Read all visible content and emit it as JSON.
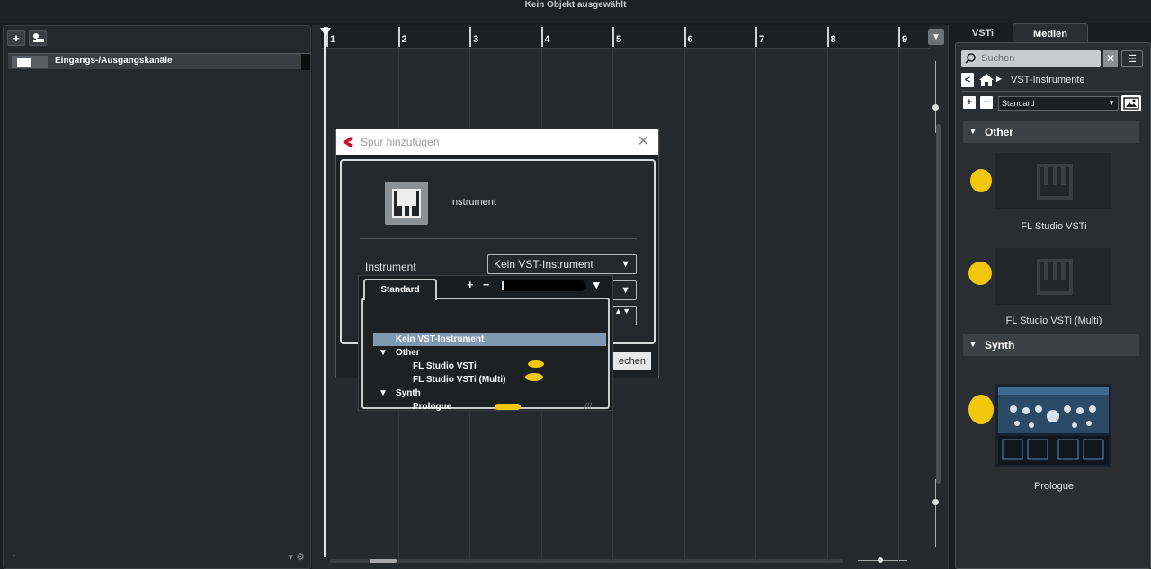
{
  "topbar": {
    "title": "Kein Objekt ausgewählt"
  },
  "left": {
    "add_label": "+",
    "track_label": "Eingangs-/Ausgangskanäle",
    "bottom_dash": "-",
    "bottom_controls": "▾ ⚙"
  },
  "ruler": {
    "bars": [
      "1",
      "2",
      "3",
      "4",
      "5",
      "6",
      "7",
      "8",
      "9"
    ]
  },
  "right": {
    "tabs": [
      "VSTi",
      "Medien"
    ],
    "search_placeholder": "Suchen",
    "clear": "✕",
    "list": "☰",
    "back": "<",
    "crumb": "VST-Instrumente",
    "plus": "+",
    "minus": "−",
    "preset": "Standard",
    "sections": [
      {
        "title": "Other",
        "items": [
          "FL Studio VSTi",
          "FL Studio VSTi (Multi)"
        ]
      },
      {
        "title": "Synth",
        "items": [
          "Prologue"
        ]
      }
    ]
  },
  "dialog": {
    "title": "Spur hinzufügen",
    "close": "✕",
    "instrument_type": "Instrument",
    "field_label": "Instrument",
    "field_value": "Kein VST-Instrument",
    "dd_arrow": "▼",
    "spinner": "▲▼",
    "button": "echen"
  },
  "popup": {
    "tab": "Standard",
    "plus": "+",
    "minus": "−",
    "menu_arrow": "▾",
    "items": [
      {
        "label": "Kein VST-Instrument",
        "kind": "item"
      },
      {
        "label": "Other",
        "kind": "folder"
      },
      {
        "label": "FL Studio VSTi",
        "kind": "child"
      },
      {
        "label": "FL Studio VSTi (Multi)",
        "kind": "child"
      },
      {
        "label": "Synth",
        "kind": "folder"
      },
      {
        "label": "Prologue",
        "kind": "child"
      }
    ],
    "grip": "///"
  },
  "colors": {
    "accent_yellow": "#f2c80e",
    "selection": "#8099b3",
    "background": "#1a1d20"
  }
}
